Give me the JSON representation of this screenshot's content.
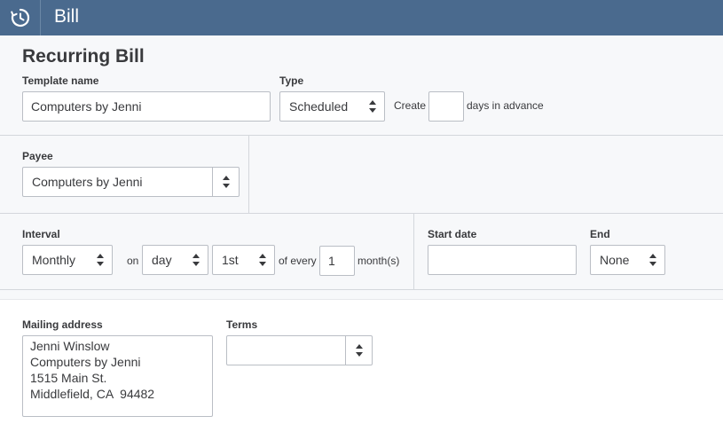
{
  "header": {
    "title": "Bill",
    "icon": "recurring-clock-icon"
  },
  "form": {
    "heading": "Recurring Bill",
    "template_name": {
      "label": "Template name",
      "value": "Computers by Jenni"
    },
    "type": {
      "label": "Type",
      "value": "Scheduled",
      "create_prefix": "Create",
      "days_value": "",
      "days_suffix": "days in advance"
    },
    "payee": {
      "label": "Payee",
      "value": "Computers by Jenni"
    },
    "interval": {
      "label": "Interval",
      "frequency": "Monthly",
      "on_label": "on",
      "day_type": "day",
      "day_ordinal": "1st",
      "of_every_label": "of every",
      "every_value": "1",
      "unit_label": "month(s)"
    },
    "start_date": {
      "label": "Start date",
      "value": ""
    },
    "end": {
      "label": "End",
      "value": "None"
    },
    "mailing_address": {
      "label": "Mailing address",
      "lines": [
        "Jenni Winslow",
        "Computers by Jenni",
        "1515 Main St.",
        "Middlefield, CA  94482"
      ]
    },
    "terms": {
      "label": "Terms",
      "value": ""
    }
  },
  "colors": {
    "header_bg": "#4a6a8e",
    "form_bg": "#f7f8fa",
    "border": "#babec5"
  }
}
